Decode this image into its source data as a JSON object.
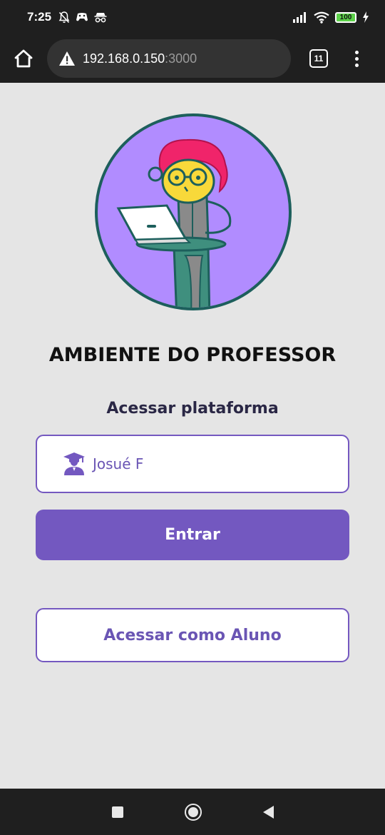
{
  "status_bar": {
    "time": "7:25",
    "battery": "100",
    "icons": [
      "notifications-off-icon",
      "gamepad-icon",
      "incognito-icon",
      "signal-icon",
      "wifi-icon",
      "battery-icon",
      "charging-icon"
    ]
  },
  "browser": {
    "url_host": "192.168.0.150",
    "url_port": ":3000",
    "tab_count": "11",
    "icons": [
      "home-icon",
      "warning-icon",
      "menu-dots-icon"
    ]
  },
  "page": {
    "title": "AMBIENTE DO PROFESSOR",
    "subtitle": "Acessar plataforma",
    "name_field": {
      "value": "Josué F",
      "icon": "graduate-user-icon"
    },
    "enter_button": "Entrar",
    "student_button": "Acessar como Aluno"
  },
  "colors": {
    "accent": "#7358c0",
    "avatar_bg": "#b18cff",
    "avatar_border": "#1d5f5c",
    "background": "#e5e5e5"
  }
}
